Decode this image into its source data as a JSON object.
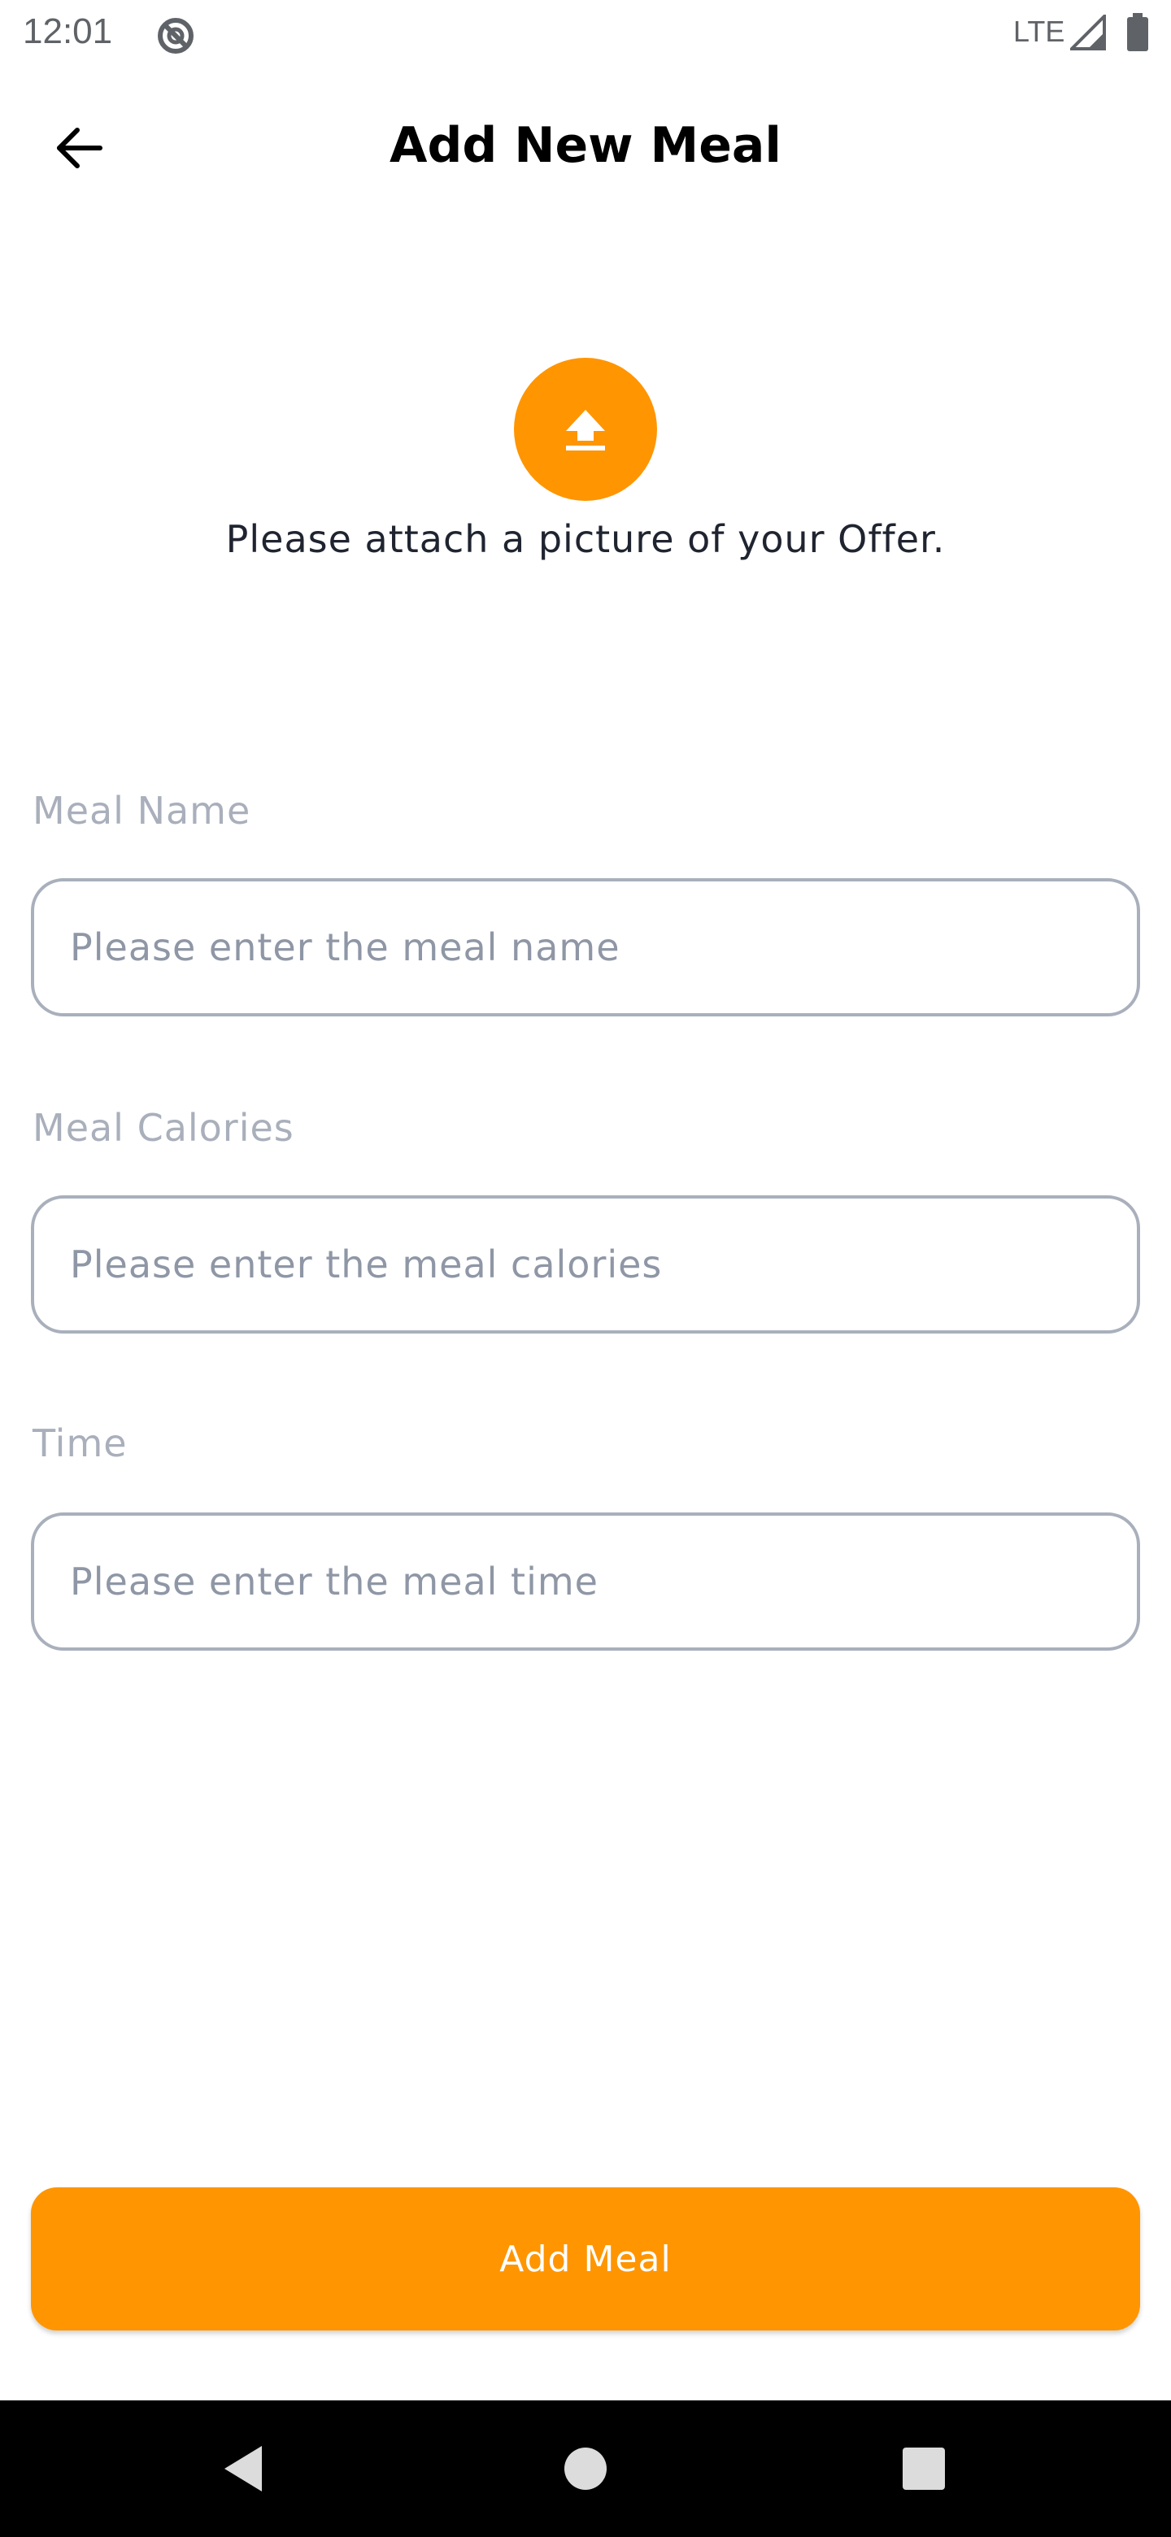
{
  "status_bar": {
    "time": "12:01",
    "network": "LTE",
    "icons": [
      "dnd-icon",
      "signal-icon",
      "battery-icon"
    ]
  },
  "header": {
    "title": "Add New Meal",
    "back_icon": "arrow-left-icon"
  },
  "upload": {
    "icon": "upload-icon",
    "hint": "Please attach a picture of your Offer."
  },
  "form": {
    "fields": [
      {
        "label": "Meal Name",
        "placeholder": "Please enter the meal name",
        "value": ""
      },
      {
        "label": "Meal Calories",
        "placeholder": "Please enter the meal calories",
        "value": ""
      },
      {
        "label": "Time",
        "placeholder": "Please enter the meal time",
        "value": ""
      }
    ]
  },
  "submit": {
    "label": "Add Meal"
  },
  "nav_bar": {
    "icons": [
      "nav-back-icon",
      "nav-home-icon",
      "nav-recents-icon"
    ]
  },
  "colors": {
    "accent": "#ff9500",
    "input_border": "#a9b0bc",
    "label": "#a9afbb",
    "placeholder": "#8f97a6",
    "text": "#1f2430"
  }
}
